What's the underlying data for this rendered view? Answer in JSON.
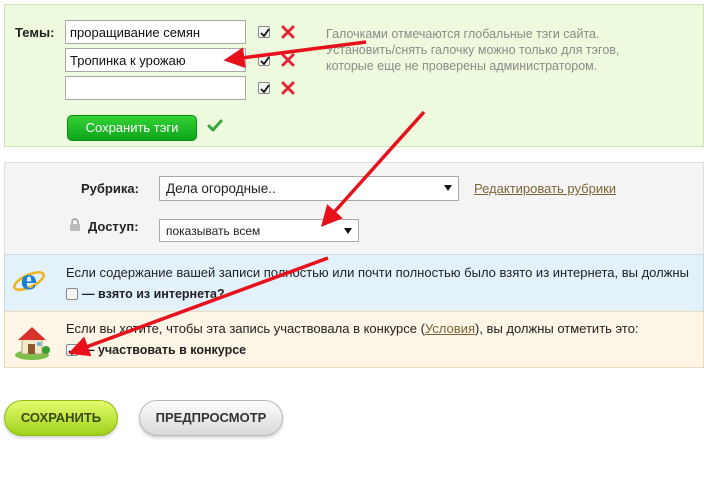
{
  "tags": {
    "label": "Темы:",
    "rows": [
      {
        "value": "проращивание семян",
        "checked": true
      },
      {
        "value": "Тропинка к урожаю",
        "checked": true
      },
      {
        "value": "",
        "checked": true
      }
    ],
    "help_lines": [
      "Галочками отмечаются глобальные тэги сайта.",
      "Установить/снять галочку можно только для тэгов,",
      "которые еще не проверены администратором."
    ],
    "save_label": "Сохранить тэги"
  },
  "rubric": {
    "label": "Рубрика:",
    "selected": "Дела огородные..",
    "edit_link": "Редактировать рубрики"
  },
  "access": {
    "label": "Доступ:",
    "selected": "показывать всем"
  },
  "source": {
    "text": "Если содержание вашей записи полностью или почти полностью было взято из интернета, вы должны",
    "checkbox_label": "— взято из интернета?",
    "checked": false
  },
  "contest": {
    "text_before": "Если вы хотите, чтобы эта запись участвовала в конкурсе (",
    "link": "Условия",
    "text_after": "), вы должны отметить это:",
    "checkbox_label": "— участвовать в конкурсе",
    "checked": true
  },
  "actions": {
    "save_label": "СОХРАНИТЬ",
    "preview_label": "ПРЕДПРОСМОТР"
  },
  "colors": {
    "annotation_arrow": "#e8101a",
    "delete_x": "#e0263a",
    "confirm_check": "#3aa63a",
    "link": "#7b6537"
  }
}
